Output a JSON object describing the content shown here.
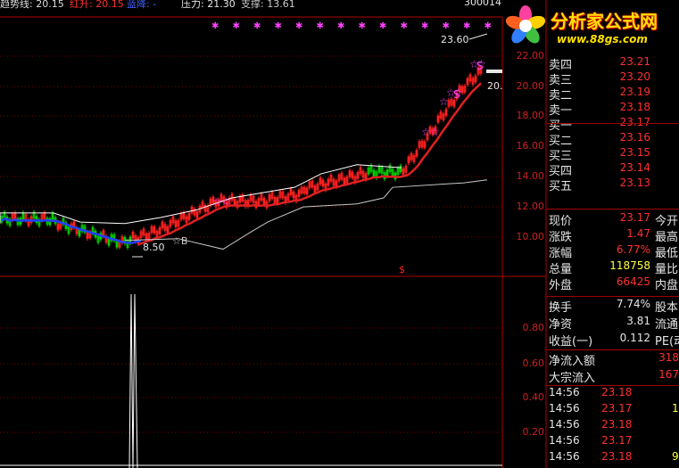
{
  "header": {
    "trend_label": "趋势线: 20.15",
    "red_label": "红升: 20.15",
    "blue_label": "蓝降: -",
    "pressure_label": "压力: 21.30",
    "support_label": "支撑: 13.61",
    "top_right": "300014"
  },
  "logo": {
    "title": "分析家公式网",
    "url": "www.88gs.com"
  },
  "price_axis": [
    "22.00",
    "20.00",
    "18.00",
    "16.00",
    "14.00",
    "12.00",
    "10.00"
  ],
  "indicator_axis": [
    "0.80",
    "0.60",
    "0.40",
    "0.20"
  ],
  "chart_annotations": {
    "high": "23.60",
    "low": "8.50",
    "right_edge_price": "20.",
    "signal_s": "S",
    "signal_b": "B",
    "dollar_marker": "$"
  },
  "order_book": [
    {
      "label": "卖四",
      "price": "23.21",
      "vol": ""
    },
    {
      "label": "卖三",
      "price": "23.20",
      "vol": ""
    },
    {
      "label": "卖二",
      "price": "23.19",
      "vol": ""
    },
    {
      "label": "卖一",
      "price": "23.18",
      "vol": ""
    },
    {
      "label": "买一",
      "price": "23.17",
      "vol": ""
    },
    {
      "label": "买二",
      "price": "23.16",
      "vol": ""
    },
    {
      "label": "买三",
      "price": "23.15",
      "vol": ""
    },
    {
      "label": "买四",
      "price": "23.14",
      "vol": ""
    },
    {
      "label": "买五",
      "price": "23.13",
      "vol": ""
    }
  ],
  "quote": [
    {
      "label": "现价",
      "value": "23.17",
      "label2": "今开"
    },
    {
      "label": "涨跌",
      "value": "1.47",
      "label2": "最高"
    },
    {
      "label": "涨幅",
      "value": "6.77%",
      "label2": "最低"
    },
    {
      "label": "总量",
      "value": "118758",
      "label2": "量比"
    },
    {
      "label": "外盘",
      "value": "66425",
      "label2": "内盘"
    }
  ],
  "fundamentals": [
    {
      "label": "换手",
      "value": "7.74%",
      "label2": "股本"
    },
    {
      "label": "净资",
      "value": "3.81",
      "label2": "流通"
    },
    {
      "label": "收益(一)",
      "value": "0.112",
      "label2": "PE(动)"
    }
  ],
  "flows": [
    {
      "label": "净流入额",
      "value": "318"
    },
    {
      "label": "大宗流入",
      "value": "167"
    }
  ],
  "ticks": [
    {
      "time": "14:56",
      "price": "23.18",
      "color": "red",
      "vol": ""
    },
    {
      "time": "14:56",
      "price": "23.17",
      "color": "red",
      "vol": "1"
    },
    {
      "time": "14:56",
      "price": "23.18",
      "color": "red",
      "vol": ""
    },
    {
      "time": "14:56",
      "price": "23.17",
      "color": "red",
      "vol": ""
    },
    {
      "time": "14:56",
      "price": "23.18",
      "color": "red",
      "vol": "9"
    }
  ],
  "colors": {
    "background": "#000000",
    "grid": "#7a0000",
    "up": "#ff2020",
    "down": "#00d000",
    "trend": "#e02020",
    "blue_trend": "#2040ff",
    "pressure": "#ffffff",
    "support": "#c8c8c8",
    "star": "#ff40ff"
  }
}
